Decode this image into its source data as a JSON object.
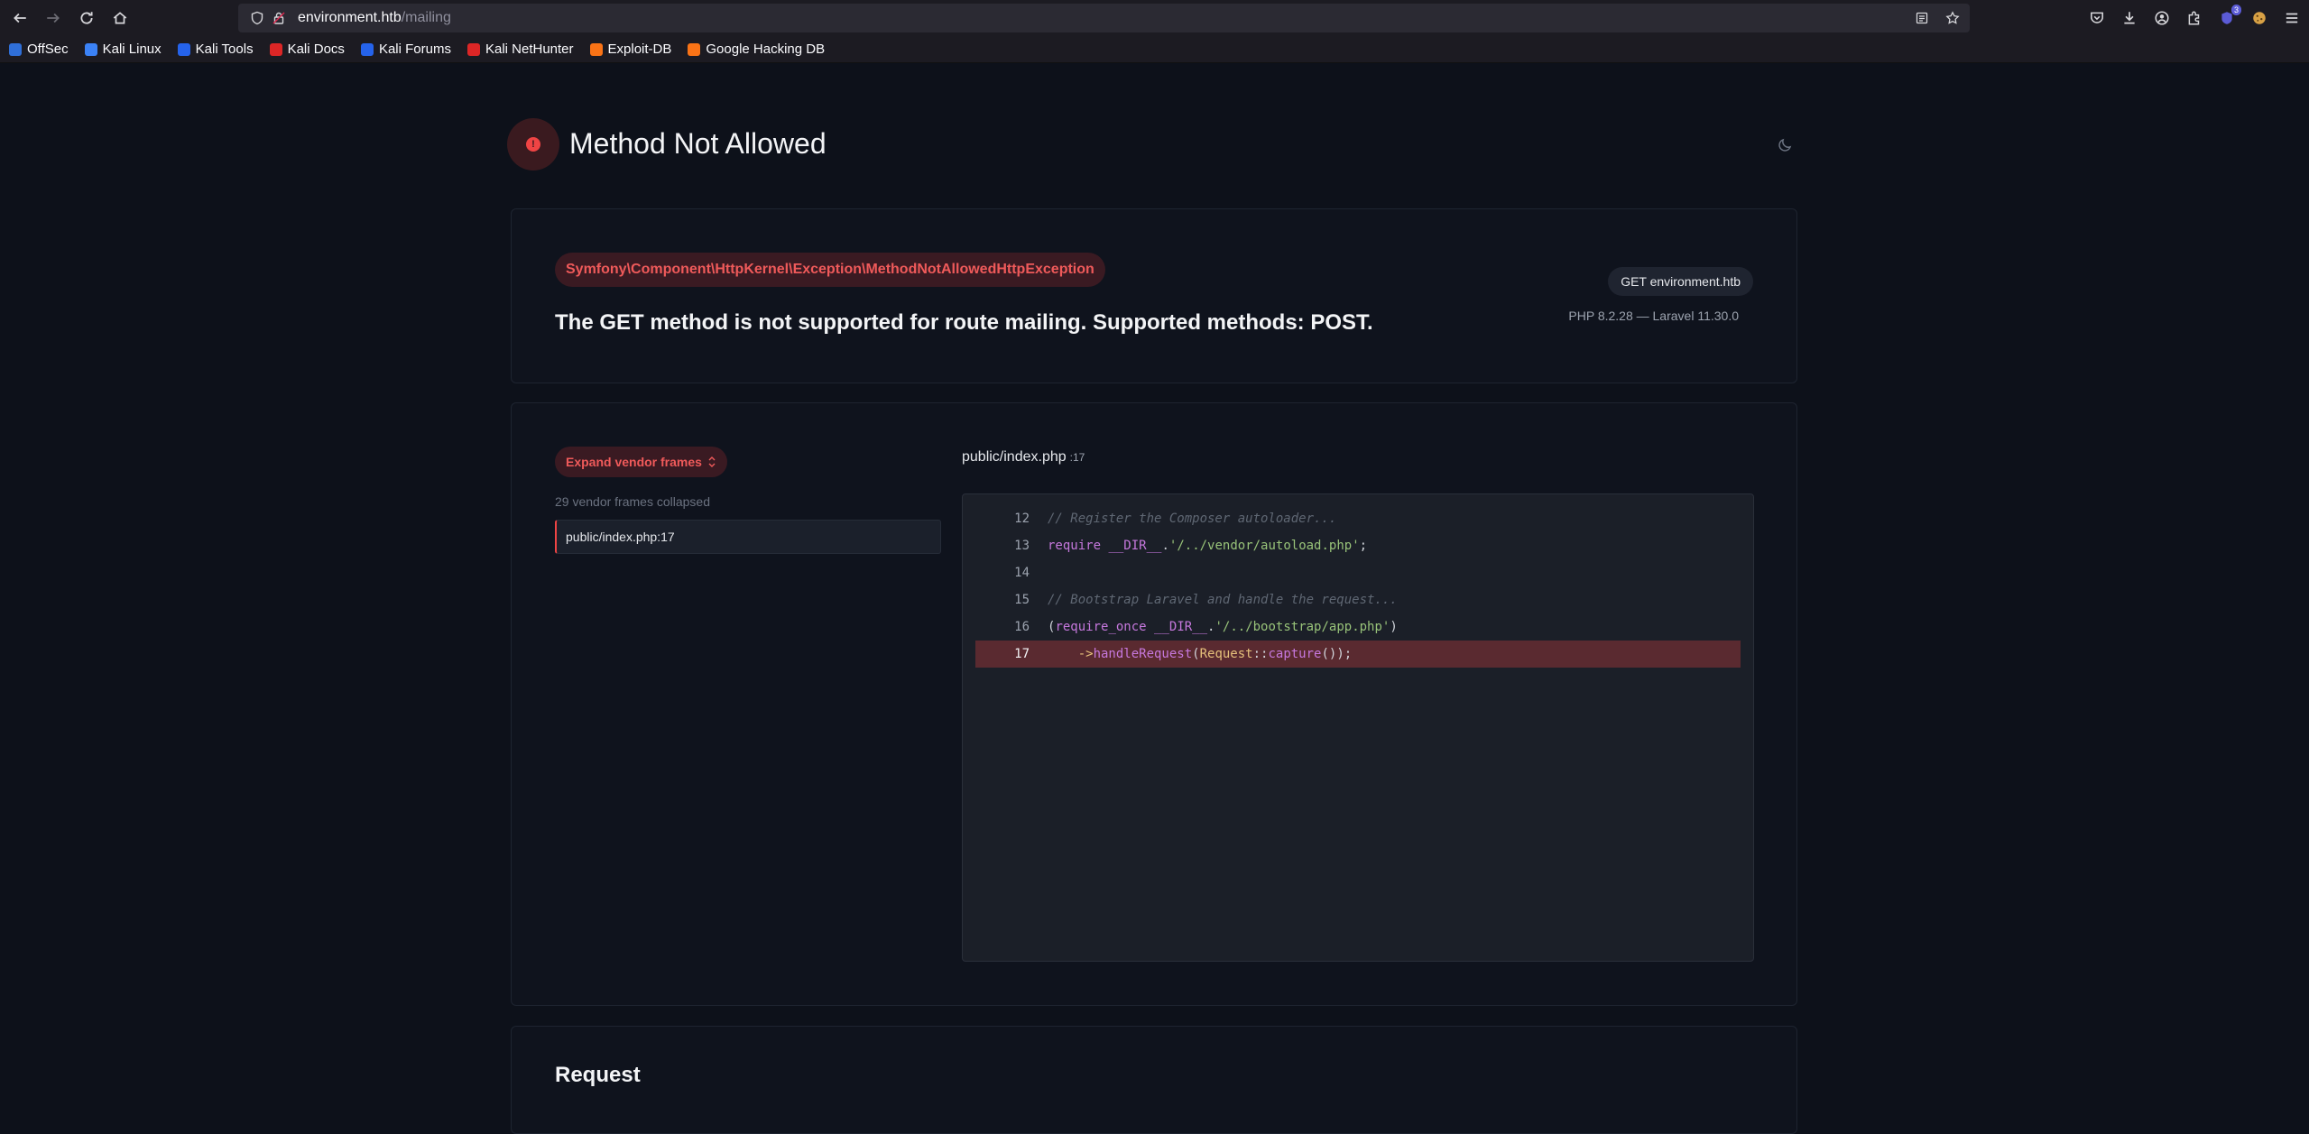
{
  "browser": {
    "url_host": "environment.htb",
    "url_path": "/mailing",
    "toolbar_badge": "3"
  },
  "bookmarks": [
    {
      "label": "OffSec",
      "icon": "offsec-icon",
      "color": "#2f6fd8"
    },
    {
      "label": "Kali Linux",
      "icon": "kali-dragon-icon",
      "color": "#3b82f6"
    },
    {
      "label": "Kali Tools",
      "icon": "kali-tools-icon",
      "color": "#2563eb"
    },
    {
      "label": "Kali Docs",
      "icon": "kali-docs-icon",
      "color": "#dc2626"
    },
    {
      "label": "Kali Forums",
      "icon": "kali-forums-icon",
      "color": "#2563eb"
    },
    {
      "label": "Kali NetHunter",
      "icon": "nethunter-icon",
      "color": "#dc2626"
    },
    {
      "label": "Exploit-DB",
      "icon": "exploit-db-icon",
      "color": "#f97316"
    },
    {
      "label": "Google Hacking DB",
      "icon": "ghdb-icon",
      "color": "#f97316"
    }
  ],
  "page": {
    "title": "Method Not Allowed",
    "exception_class": "Symfony\\Component\\HttpKernel\\Exception\\MethodNotAllowedHttpException",
    "exception_message": "The GET method is not supported for route mailing. Supported methods: POST.",
    "request_pill": "GET environment.htb",
    "versions": "PHP 8.2.28 — Laravel 11.30.0"
  },
  "trace": {
    "expand_label": "Expand vendor frames",
    "vendor_collapsed": "29 vendor frames collapsed",
    "frame_label": "public/index.php:17",
    "file_path": "public/index.php",
    "file_line": ":17"
  },
  "code": {
    "lines": [
      {
        "n": "12",
        "comment": "// Register the Composer autoloader..."
      },
      {
        "n": "13",
        "kw": "require",
        "const": "__DIR__",
        "sep": ".",
        "str": "'/../vendor/autoload.php'",
        "end": ";"
      },
      {
        "n": "14"
      },
      {
        "n": "15",
        "comment": "// Bootstrap Laravel and handle the request..."
      },
      {
        "n": "16",
        "open": "(",
        "kw": "require_once",
        "const": "__DIR__",
        "sep": ".",
        "str": "'/../bootstrap/app.php'",
        "end": ")"
      },
      {
        "n": "17",
        "indent": "    ",
        "arrow": "->",
        "fn": "handleRequest",
        "p1": "(",
        "cls": "Request",
        "dc": "::",
        "fn2": "capture",
        "p2": "());"
      }
    ],
    "highlight_line": "17"
  },
  "request": {
    "title": "Request"
  },
  "colors": {
    "accent_red": "#ef4444",
    "bg": "#0d111a",
    "card": "#0f131d"
  }
}
